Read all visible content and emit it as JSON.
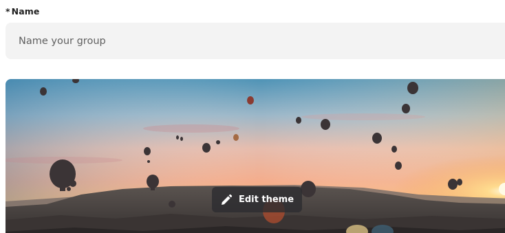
{
  "name_field": {
    "required_marker": "*",
    "label": "Name",
    "placeholder": "Name your group",
    "value": ""
  },
  "theme": {
    "edit_label": "Edit theme",
    "edit_icon": "pencil-icon"
  },
  "colors": {
    "input_background": "#f3f3f3",
    "button_background": "#2c2c30",
    "label_text": "#1f1f1f"
  }
}
